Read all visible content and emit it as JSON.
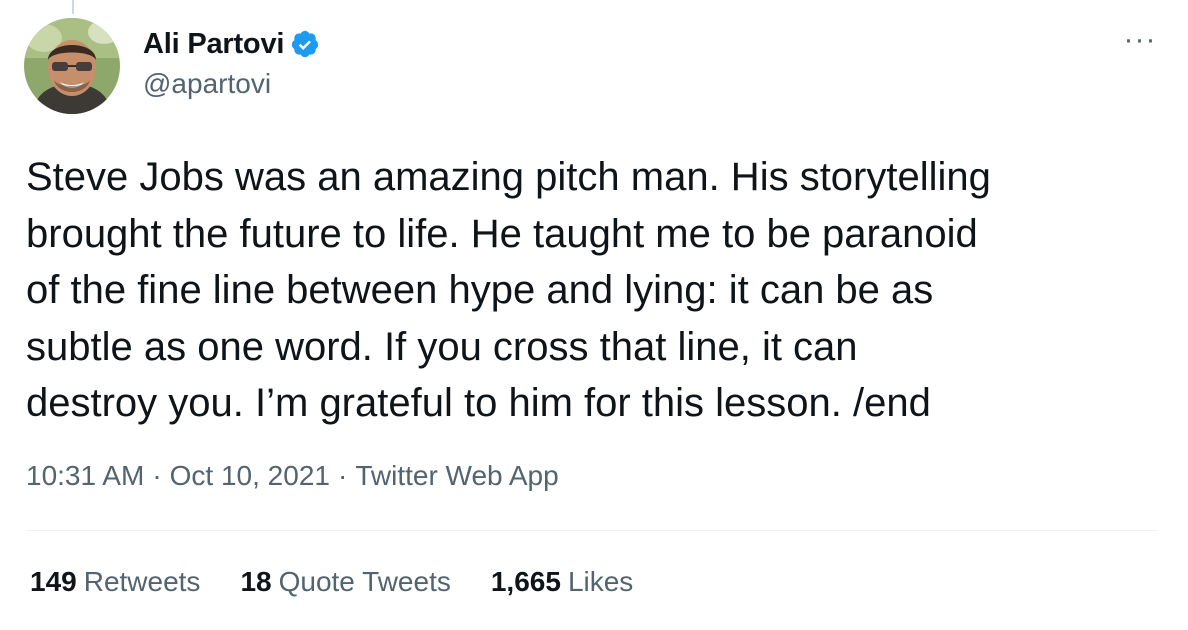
{
  "author": {
    "display_name": "Ali Partovi",
    "handle": "@apartovi",
    "verified": true,
    "verified_color": "#1d9bf0"
  },
  "tweet": {
    "text": "Steve Jobs was an amazing pitch man. His storytelling\nbrought the future to life. He taught me to be paranoid\nof the fine line between hype and lying: it can be as\nsubtle as one word. If you cross that line, it can\ndestroy you. I’m grateful to him for this lesson.  /end",
    "time": "10:31 AM",
    "date": "Oct 10, 2021",
    "source": "Twitter Web App",
    "separator": "·"
  },
  "stats": {
    "retweets": {
      "count": "149",
      "label": "Retweets"
    },
    "quote_tweets": {
      "count": "18",
      "label": "Quote Tweets"
    },
    "likes": {
      "count": "1,665",
      "label": "Likes"
    }
  },
  "more_button": {
    "label": "···"
  },
  "icons": {
    "more": "more-options-icon",
    "verified": "verified-badge-icon"
  },
  "colors": {
    "text_primary": "#0f1419",
    "text_secondary": "#536471",
    "divider": "#eff3f4",
    "accent": "#1d9bf0"
  }
}
